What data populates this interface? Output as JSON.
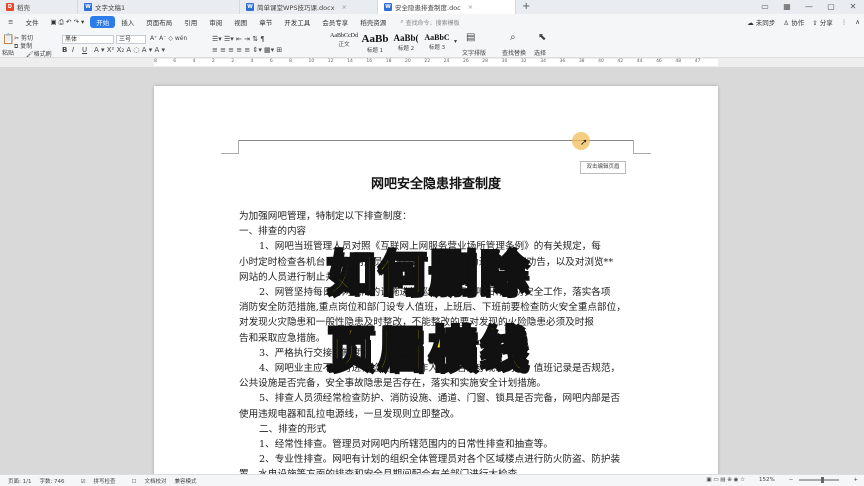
{
  "tabs": [
    {
      "label": "稻壳",
      "icon": "docer-icon",
      "active": false
    },
    {
      "label": "文字文稿1",
      "icon": "wps-writer-icon",
      "active": false
    },
    {
      "label": "简单课堂WPS技巧课.docx",
      "icon": "wps-writer-icon",
      "active": false
    },
    {
      "label": "安全隐患排查制度.doc",
      "icon": "wps-writer-icon",
      "active": true
    }
  ],
  "menu": {
    "file": "文件",
    "items": [
      "开始",
      "插入",
      "页面布局",
      "引用",
      "审阅",
      "视图",
      "章节",
      "开发工具",
      "会员专享",
      "稻壳资源"
    ],
    "search": "查找命令、搜索模板",
    "right": [
      "未同步",
      "协作",
      "分享"
    ]
  },
  "ribbon": {
    "paste": "粘贴",
    "cut": "剪切",
    "copy": "复制",
    "format_painter": "格式刷",
    "font_name": "黑体",
    "font_size": "三号",
    "styles": [
      {
        "preview": "AaBbCcDd",
        "label": "正文"
      },
      {
        "preview": "AaBb",
        "label": "标题 1"
      },
      {
        "preview": "AaBb(",
        "label": "标题 2"
      },
      {
        "preview": "AaBbC",
        "label": "标题 3"
      }
    ],
    "text_layout": "文字排版",
    "find_replace": "查找替换",
    "select": "选择"
  },
  "ruler_ticks": [
    "8",
    "6",
    "4",
    "2",
    "2",
    "4",
    "6",
    "8",
    "10",
    "12",
    "14",
    "16",
    "18",
    "20",
    "22",
    "24",
    "26",
    "28",
    "30",
    "32",
    "34",
    "36",
    "38",
    "40",
    "42",
    "44",
    "46",
    "48",
    "47"
  ],
  "header_button": "双击编辑页眉",
  "doc": {
    "title": "网吧安全隐患排查制度",
    "lines": [
      {
        "text": "为加强网吧管理，特制定以下排查制度：",
        "indent": false
      },
      {
        "text": "一、排查的内容",
        "indent": false
      },
      {
        "text": "1、网吧当班管理人员对照《互联网上网服务营业场所管理条例》的有关规定，每",
        "indent": true
      },
      {
        "text": "小时定时检查各机台，对上网人员进行登记，对违规行为进行制止和劝告，以及对浏览**",
        "indent": false
      },
      {
        "text": "网站的人员进行制止并教育。",
        "indent": false
      },
      {
        "text": "2、网管坚持每日对网吧内的设施进行巡查，负责网吧日常消防安全工作，落实各项",
        "indent": true
      },
      {
        "text": "消防安全防范措施,重点岗位和部门设专人值班，上班后、下班前要检查防火安全重点部位，",
        "indent": false
      },
      {
        "text": "对发现火灾隐患和一般性隐患及时整改，不能整改的要对发现的火险隐患必须及时报",
        "indent": false
      },
      {
        "text": "告和采取应急措施。",
        "indent": false
      },
      {
        "text": "3、严格执行交接班制度。",
        "indent": true
      },
      {
        "text": "4、网吧业主应不定时进行检查员工工作人员是否遵守规章制度，值班记录是否规范，",
        "indent": true
      },
      {
        "text": "公共设施是否完备，安全事故隐患是否存在，落实和实施安全计划措施。",
        "indent": false
      },
      {
        "text": "5、排查人员须经常检查防护、消防设施、通道、门窗、锁具是否完备，网吧内部是否",
        "indent": true
      },
      {
        "text": "使用违规电器和乱拉电源线，一旦发现则立即整改。",
        "indent": false
      },
      {
        "text": "二、排查的形式",
        "indent": true
      },
      {
        "text": "1、经常性排查。管理员对网吧内所辖范围内的日常性排查和抽查等。",
        "indent": true
      },
      {
        "text": "2、专业性排查。网吧有计划的组织全体管理员对各个区域楼点进行防火防盗、防护装",
        "indent": true
      },
      {
        "text": "置、水电设施等方面的排查和安全月期间配合有关部门进行大检查。",
        "indent": false
      }
    ]
  },
  "overlay": {
    "line1": "如何删除",
    "line2": "页眉横线"
  },
  "status": {
    "page": "页面: 1/1",
    "words": "字数: 746",
    "spell": "拼写检查",
    "proof": "文档校对",
    "compat": "兼容模式",
    "zoom": "152%"
  },
  "colors": {
    "accent": "#2b7de9",
    "overlay_fill": "#ffe400",
    "overlay_stroke": "#111111"
  }
}
